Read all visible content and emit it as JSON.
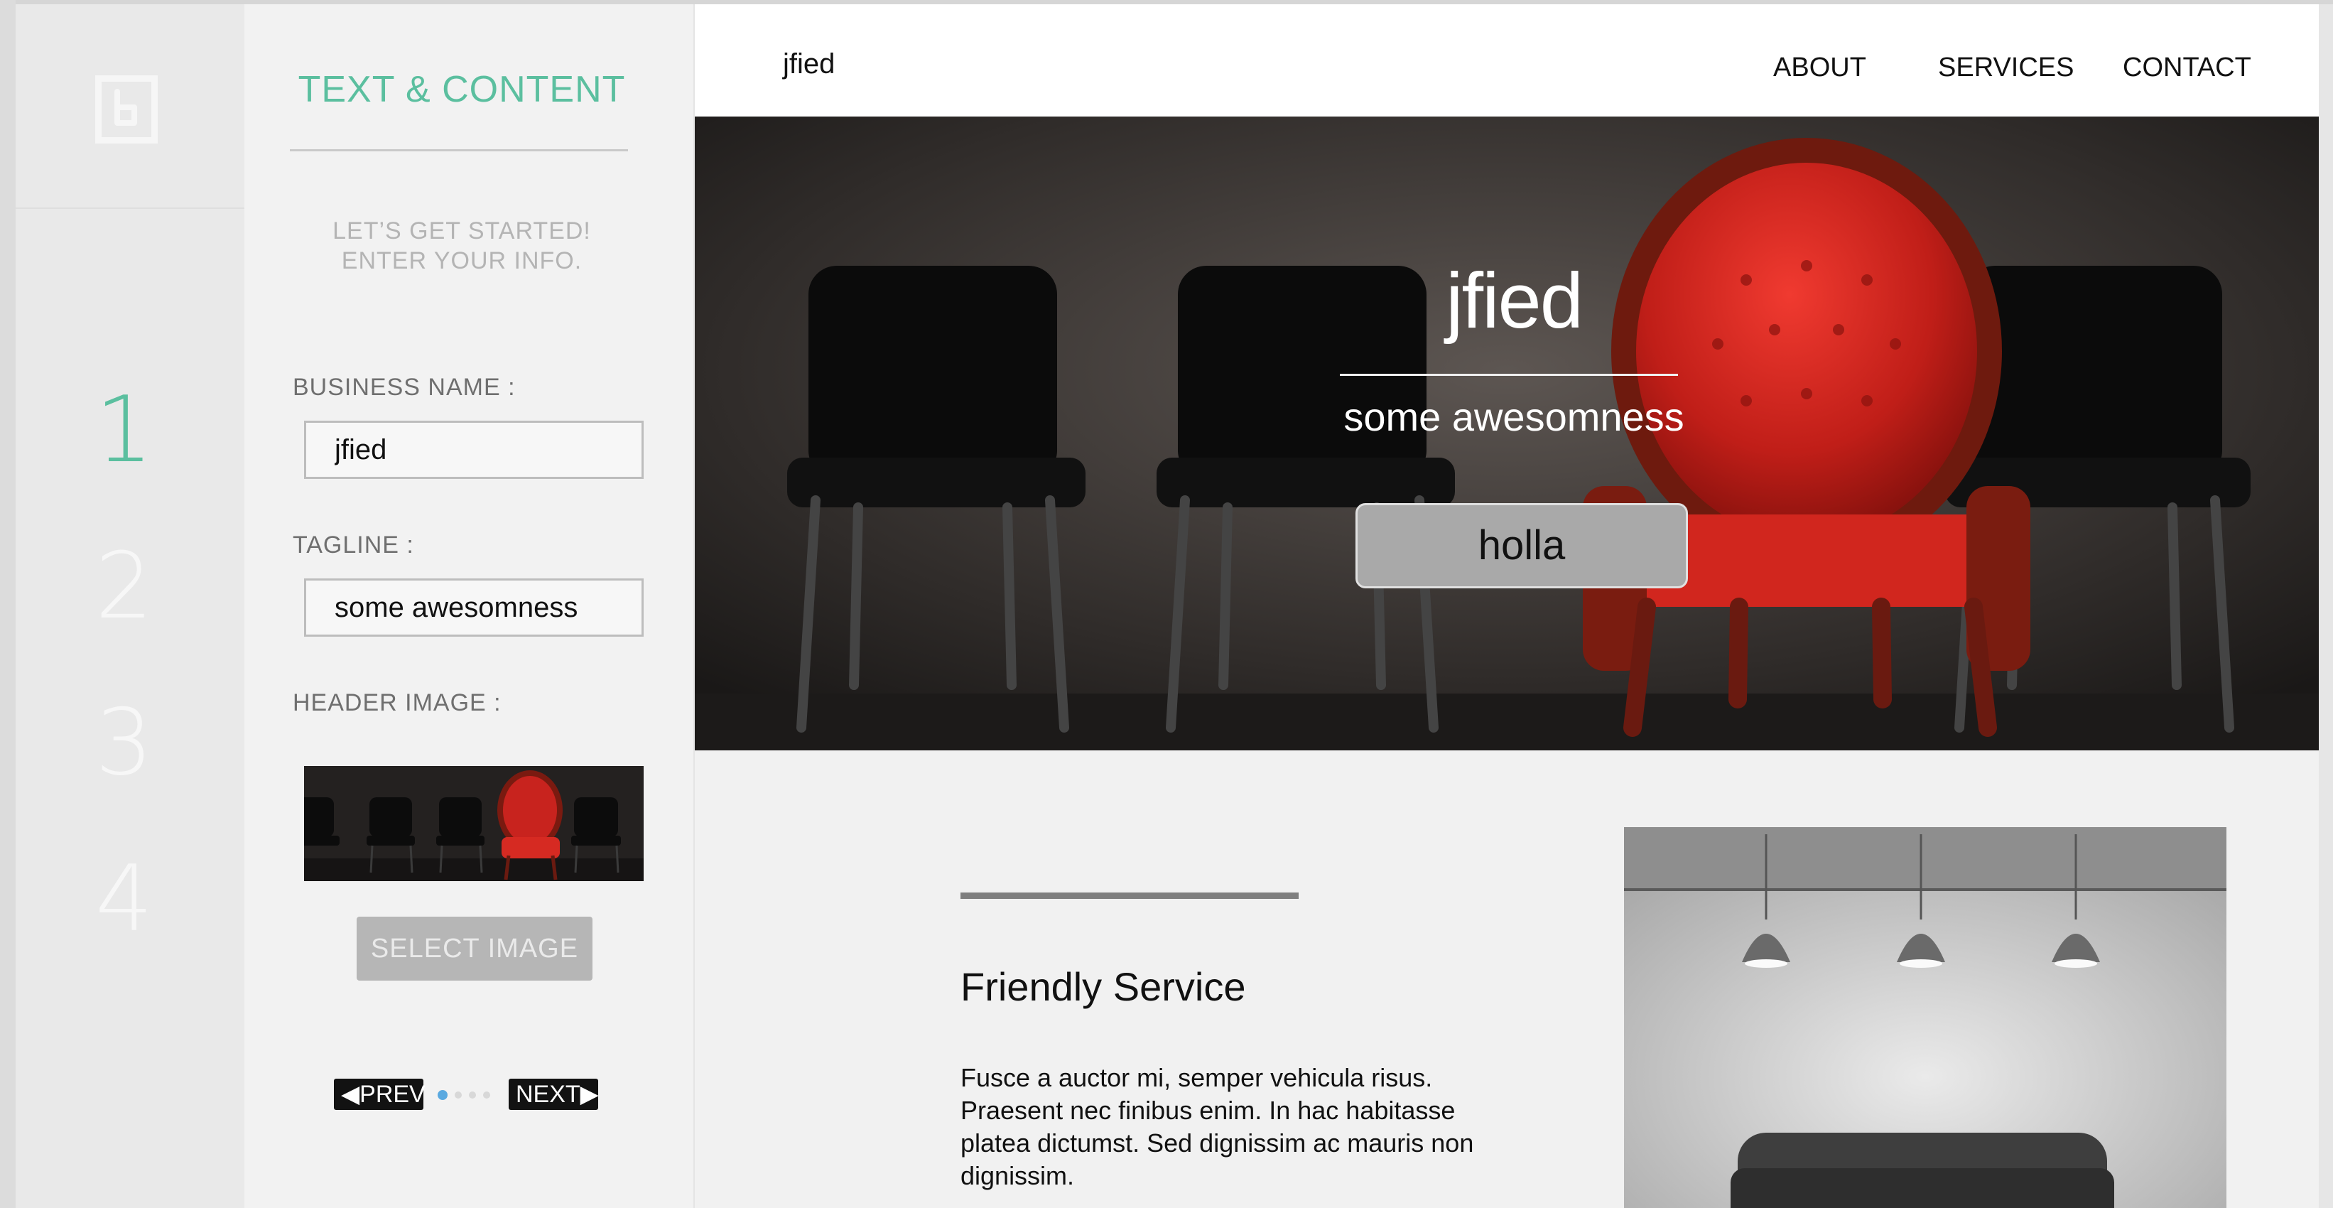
{
  "sidebar": {
    "steps": [
      "1",
      "2",
      "3",
      "4"
    ],
    "active_step": "1"
  },
  "panel": {
    "title": "TEXT & CONTENT",
    "intro_line1": "LET’S GET STARTED!",
    "intro_line2": "ENTER YOUR INFO.",
    "business_name_label": "BUSINESS NAME :",
    "business_name_value": "jfied",
    "tagline_label": "TAGLINE :",
    "tagline_value": "some awesomness",
    "header_image_label": "HEADER IMAGE :",
    "select_image_label": "SELECT IMAGE",
    "prev_label": "◀PREV",
    "next_label": "NEXT▶",
    "page_count": 4,
    "current_page": 1
  },
  "preview": {
    "brand": "jfied",
    "nav": [
      "ABOUT",
      "SERVICES",
      "CONTACT"
    ],
    "hero_title": "jfied",
    "hero_tagline": "some awesomness",
    "hero_button": "holla",
    "section_title": "Friendly Service",
    "section_body": "Fusce a auctor mi, semper vehicula risus. Praesent nec finibus enim. In hac habitasse platea dictumst. Sed dignissim ac mauris non dignissim."
  },
  "colors": {
    "accent": "#5bbf9f",
    "hero_chair": "#c8231e",
    "active_dot": "#5aa9e0"
  },
  "icons": [
    "b-logo-icon",
    "prev-arrow-icon",
    "next-arrow-icon"
  ]
}
